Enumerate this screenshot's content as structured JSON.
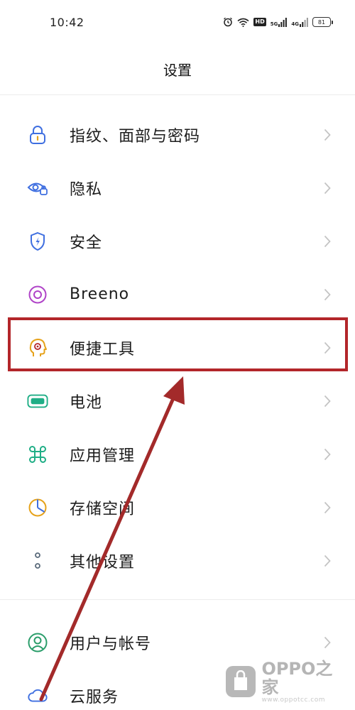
{
  "status_bar": {
    "time": "10:42",
    "hd": "HD",
    "net1": "5G",
    "net2": "4G",
    "battery": "81"
  },
  "header": {
    "title": "设置"
  },
  "settings": {
    "items": [
      {
        "label": "指纹、面部与密码",
        "icon": "lock-icon",
        "color": "#3f6fe0"
      },
      {
        "label": "隐私",
        "icon": "privacy-eye-icon",
        "color": "#3f6fe0"
      },
      {
        "label": "安全",
        "icon": "shield-bolt-icon",
        "color": "#3f6fe0"
      },
      {
        "label": "Breeno",
        "icon": "breeno-ring-icon",
        "color": "#b044c8"
      },
      {
        "label": "便捷工具",
        "icon": "head-target-icon",
        "color": "#e6a21a"
      },
      {
        "label": "电池",
        "icon": "battery-icon",
        "color": "#1fae86"
      },
      {
        "label": "应用管理",
        "icon": "apps-grid-icon",
        "color": "#1fae86"
      },
      {
        "label": "存储空间",
        "icon": "storage-pie-icon",
        "color": "#e6a21a"
      },
      {
        "label": "其他设置",
        "icon": "more-dots-icon",
        "color": "#5a6a7a"
      },
      {
        "label": "用户与帐号",
        "icon": "user-icon",
        "color": "#2a9d6a"
      },
      {
        "label": "云服务",
        "icon": "cloud-icon",
        "color": "#3f6fe0"
      }
    ]
  },
  "annotation": {
    "highlight_color": "#b3262a",
    "arrow_color": "#a32a2a"
  },
  "watermark": {
    "brand": "OPPO之家",
    "url": "www.oppotcc.com"
  }
}
